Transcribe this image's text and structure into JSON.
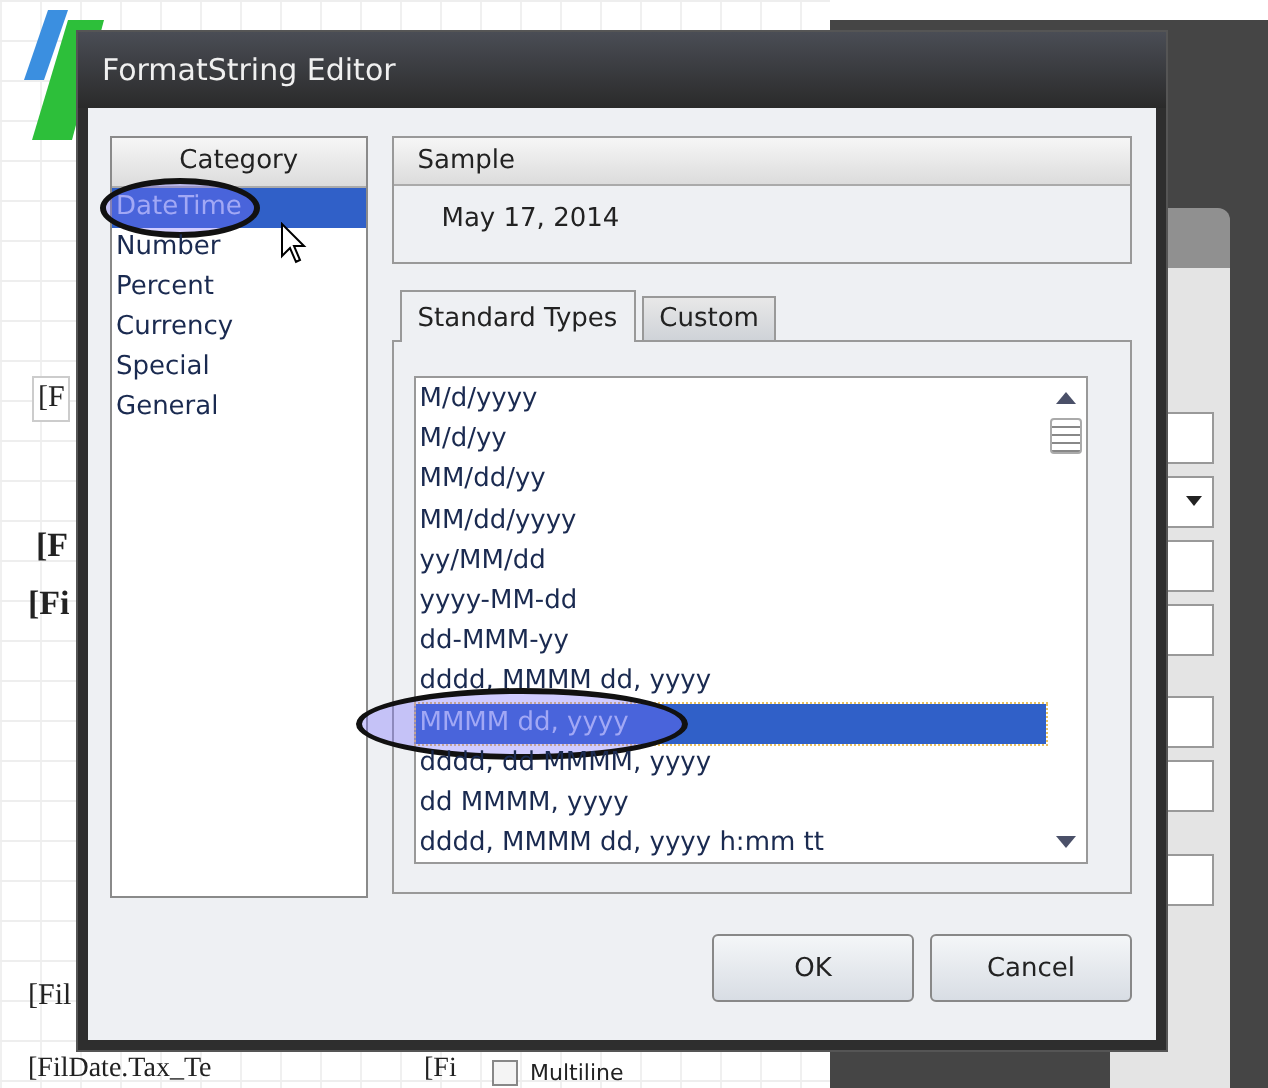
{
  "window": {
    "title": "FormatString Editor"
  },
  "category": {
    "header": "Category",
    "items": [
      {
        "label": "DateTime",
        "selected": true,
        "circled": true
      },
      {
        "label": "Number",
        "selected": false,
        "circled": false
      },
      {
        "label": "Percent",
        "selected": false,
        "circled": false
      },
      {
        "label": "Currency",
        "selected": false,
        "circled": false
      },
      {
        "label": "Special",
        "selected": false,
        "circled": false
      },
      {
        "label": "General",
        "selected": false,
        "circled": false
      }
    ]
  },
  "sample": {
    "header": "Sample",
    "value": "May 17, 2014"
  },
  "tabs": [
    {
      "label": "Standard Types",
      "selected": true
    },
    {
      "label": "Custom",
      "selected": false
    }
  ],
  "formats": [
    {
      "label": "M/d/yyyy",
      "selected": false,
      "circled": false
    },
    {
      "label": "M/d/yy",
      "selected": false,
      "circled": false
    },
    {
      "label": "MM/dd/yy",
      "selected": false,
      "circled": false
    },
    {
      "label": "MM/dd/yyyy",
      "selected": false,
      "circled": false
    },
    {
      "label": "yy/MM/dd",
      "selected": false,
      "circled": false
    },
    {
      "label": "yyyy-MM-dd",
      "selected": false,
      "circled": false
    },
    {
      "label": "dd-MMM-yy",
      "selected": false,
      "circled": false
    },
    {
      "label": "dddd, MMMM dd, yyyy",
      "selected": false,
      "circled": false
    },
    {
      "label": "MMMM dd, yyyy",
      "selected": true,
      "circled": true
    },
    {
      "label": "dddd, dd MMMM, yyyy",
      "selected": false,
      "circled": false
    },
    {
      "label": "dd MMMM, yyyy",
      "selected": false,
      "circled": false
    },
    {
      "label": "dddd, MMMM dd, yyyy h:mm tt",
      "selected": false,
      "circled": false
    }
  ],
  "buttons": [
    "OK",
    "Cancel"
  ],
  "background": {
    "fields": [
      "[F",
      "[F",
      "[Fi",
      "[Fil",
      "[FilDate.Tax_Te",
      "[Fi"
    ],
    "checkbox": {
      "label": "Multiline",
      "checked": false
    }
  }
}
